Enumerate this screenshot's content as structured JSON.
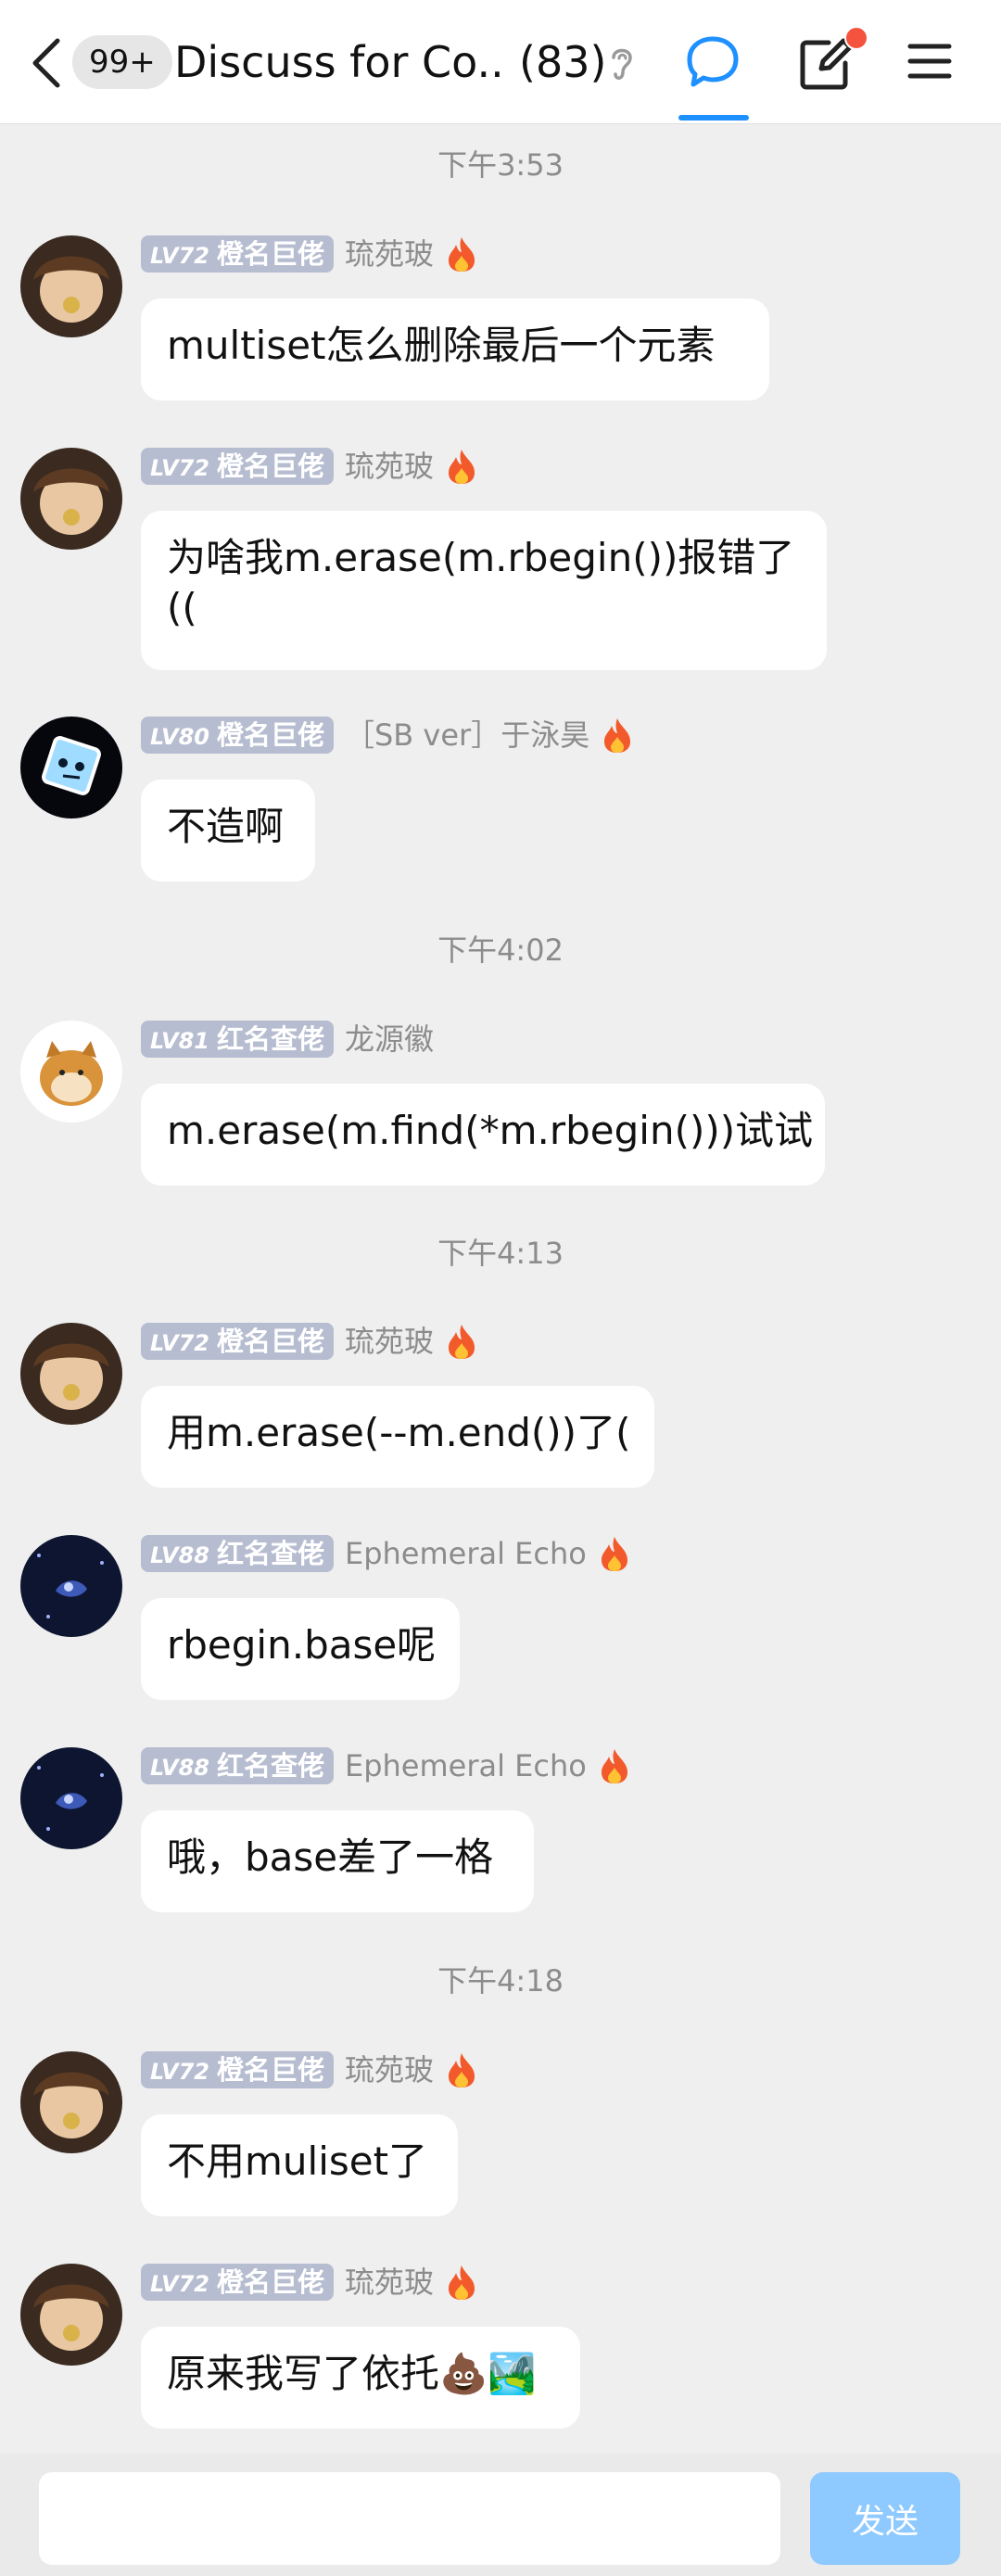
{
  "header": {
    "unread_badge": "99+",
    "group_title": "Discuss for Co...",
    "member_count": "(83)",
    "icons": [
      "back-icon",
      "ear-icon",
      "chat-icon",
      "compose-icon",
      "menu-icon"
    ]
  },
  "colors": {
    "accent": "#1e90ff",
    "send_button": "#8ec9ff",
    "notification_dot": "#f5533d",
    "level_badge": "#b7bdd0"
  },
  "timestamps": [
    "下午3:53",
    "下午4:02",
    "下午4:13",
    "下午4:18"
  ],
  "messages": [
    {
      "lv": "LV72",
      "title": "橙名巨佬",
      "sender": "琉苑玻",
      "text": "multiset怎么删除最后一个元素",
      "avatar": "anime-avatar"
    },
    {
      "lv": "LV72",
      "title": "橙名巨佬",
      "sender": "琉苑玻",
      "text": "为啥我m.erase(m.rbegin())报错了((",
      "avatar": "anime-avatar"
    },
    {
      "lv": "LV80",
      "title": "橙名巨佬",
      "sender": "［SB ver］于泳昊",
      "text": "不造啊",
      "avatar": "cube-avatar"
    },
    {
      "lv": "LV81",
      "title": "红名查佬",
      "sender": "龙源徽",
      "text": "m.erase(m.find(*m.rbegin()))试试",
      "avatar": "doge-avatar"
    },
    {
      "lv": "LV72",
      "title": "橙名巨佬",
      "sender": "琉苑玻",
      "text": "用m.erase(--m.end())了(",
      "avatar": "anime-avatar"
    },
    {
      "lv": "LV88",
      "title": "红名查佬",
      "sender": "Ephemeral Echo",
      "text": "rbegin.base呢",
      "avatar": "space-avatar"
    },
    {
      "lv": "LV88",
      "title": "红名查佬",
      "sender": "Ephemeral Echo",
      "text": "哦，base差了一格",
      "avatar": "space-avatar"
    },
    {
      "lv": "LV72",
      "title": "橙名巨佬",
      "sender": "琉苑玻",
      "text": "不用muliset了",
      "avatar": "anime-avatar"
    },
    {
      "lv": "LV72",
      "title": "橙名巨佬",
      "sender": "琉苑玻",
      "text": "原来我写了依托💩🏞️",
      "avatar": "anime-avatar"
    }
  ],
  "composer": {
    "input_value": "",
    "send_label": "发送"
  }
}
